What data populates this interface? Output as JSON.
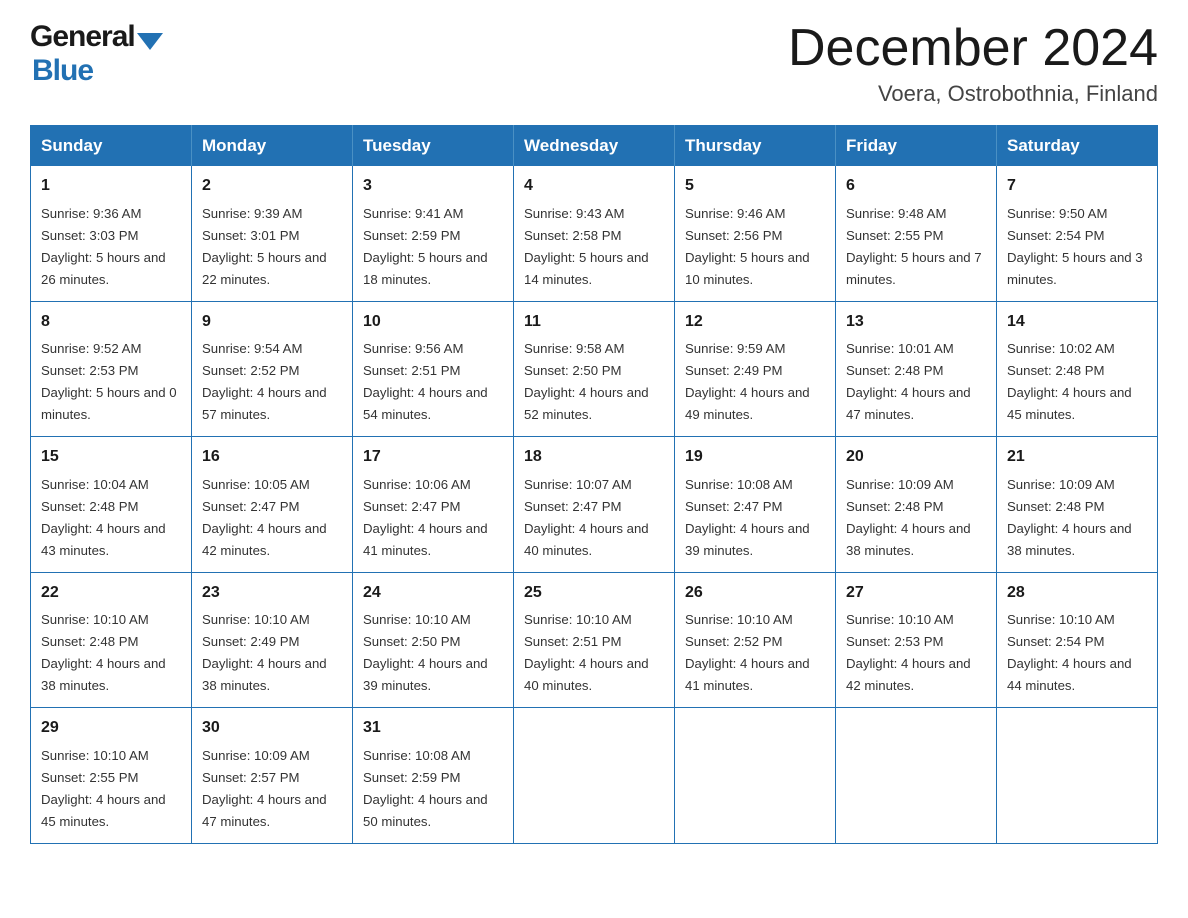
{
  "header": {
    "logo_general": "General",
    "logo_blue": "Blue",
    "month_title": "December 2024",
    "location": "Voera, Ostrobothnia, Finland"
  },
  "weekdays": [
    "Sunday",
    "Monday",
    "Tuesday",
    "Wednesday",
    "Thursday",
    "Friday",
    "Saturday"
  ],
  "weeks": [
    [
      {
        "day": "1",
        "sunrise": "Sunrise: 9:36 AM",
        "sunset": "Sunset: 3:03 PM",
        "daylight": "Daylight: 5 hours and 26 minutes."
      },
      {
        "day": "2",
        "sunrise": "Sunrise: 9:39 AM",
        "sunset": "Sunset: 3:01 PM",
        "daylight": "Daylight: 5 hours and 22 minutes."
      },
      {
        "day": "3",
        "sunrise": "Sunrise: 9:41 AM",
        "sunset": "Sunset: 2:59 PM",
        "daylight": "Daylight: 5 hours and 18 minutes."
      },
      {
        "day": "4",
        "sunrise": "Sunrise: 9:43 AM",
        "sunset": "Sunset: 2:58 PM",
        "daylight": "Daylight: 5 hours and 14 minutes."
      },
      {
        "day": "5",
        "sunrise": "Sunrise: 9:46 AM",
        "sunset": "Sunset: 2:56 PM",
        "daylight": "Daylight: 5 hours and 10 minutes."
      },
      {
        "day": "6",
        "sunrise": "Sunrise: 9:48 AM",
        "sunset": "Sunset: 2:55 PM",
        "daylight": "Daylight: 5 hours and 7 minutes."
      },
      {
        "day": "7",
        "sunrise": "Sunrise: 9:50 AM",
        "sunset": "Sunset: 2:54 PM",
        "daylight": "Daylight: 5 hours and 3 minutes."
      }
    ],
    [
      {
        "day": "8",
        "sunrise": "Sunrise: 9:52 AM",
        "sunset": "Sunset: 2:53 PM",
        "daylight": "Daylight: 5 hours and 0 minutes."
      },
      {
        "day": "9",
        "sunrise": "Sunrise: 9:54 AM",
        "sunset": "Sunset: 2:52 PM",
        "daylight": "Daylight: 4 hours and 57 minutes."
      },
      {
        "day": "10",
        "sunrise": "Sunrise: 9:56 AM",
        "sunset": "Sunset: 2:51 PM",
        "daylight": "Daylight: 4 hours and 54 minutes."
      },
      {
        "day": "11",
        "sunrise": "Sunrise: 9:58 AM",
        "sunset": "Sunset: 2:50 PM",
        "daylight": "Daylight: 4 hours and 52 minutes."
      },
      {
        "day": "12",
        "sunrise": "Sunrise: 9:59 AM",
        "sunset": "Sunset: 2:49 PM",
        "daylight": "Daylight: 4 hours and 49 minutes."
      },
      {
        "day": "13",
        "sunrise": "Sunrise: 10:01 AM",
        "sunset": "Sunset: 2:48 PM",
        "daylight": "Daylight: 4 hours and 47 minutes."
      },
      {
        "day": "14",
        "sunrise": "Sunrise: 10:02 AM",
        "sunset": "Sunset: 2:48 PM",
        "daylight": "Daylight: 4 hours and 45 minutes."
      }
    ],
    [
      {
        "day": "15",
        "sunrise": "Sunrise: 10:04 AM",
        "sunset": "Sunset: 2:48 PM",
        "daylight": "Daylight: 4 hours and 43 minutes."
      },
      {
        "day": "16",
        "sunrise": "Sunrise: 10:05 AM",
        "sunset": "Sunset: 2:47 PM",
        "daylight": "Daylight: 4 hours and 42 minutes."
      },
      {
        "day": "17",
        "sunrise": "Sunrise: 10:06 AM",
        "sunset": "Sunset: 2:47 PM",
        "daylight": "Daylight: 4 hours and 41 minutes."
      },
      {
        "day": "18",
        "sunrise": "Sunrise: 10:07 AM",
        "sunset": "Sunset: 2:47 PM",
        "daylight": "Daylight: 4 hours and 40 minutes."
      },
      {
        "day": "19",
        "sunrise": "Sunrise: 10:08 AM",
        "sunset": "Sunset: 2:47 PM",
        "daylight": "Daylight: 4 hours and 39 minutes."
      },
      {
        "day": "20",
        "sunrise": "Sunrise: 10:09 AM",
        "sunset": "Sunset: 2:48 PM",
        "daylight": "Daylight: 4 hours and 38 minutes."
      },
      {
        "day": "21",
        "sunrise": "Sunrise: 10:09 AM",
        "sunset": "Sunset: 2:48 PM",
        "daylight": "Daylight: 4 hours and 38 minutes."
      }
    ],
    [
      {
        "day": "22",
        "sunrise": "Sunrise: 10:10 AM",
        "sunset": "Sunset: 2:48 PM",
        "daylight": "Daylight: 4 hours and 38 minutes."
      },
      {
        "day": "23",
        "sunrise": "Sunrise: 10:10 AM",
        "sunset": "Sunset: 2:49 PM",
        "daylight": "Daylight: 4 hours and 38 minutes."
      },
      {
        "day": "24",
        "sunrise": "Sunrise: 10:10 AM",
        "sunset": "Sunset: 2:50 PM",
        "daylight": "Daylight: 4 hours and 39 minutes."
      },
      {
        "day": "25",
        "sunrise": "Sunrise: 10:10 AM",
        "sunset": "Sunset: 2:51 PM",
        "daylight": "Daylight: 4 hours and 40 minutes."
      },
      {
        "day": "26",
        "sunrise": "Sunrise: 10:10 AM",
        "sunset": "Sunset: 2:52 PM",
        "daylight": "Daylight: 4 hours and 41 minutes."
      },
      {
        "day": "27",
        "sunrise": "Sunrise: 10:10 AM",
        "sunset": "Sunset: 2:53 PM",
        "daylight": "Daylight: 4 hours and 42 minutes."
      },
      {
        "day": "28",
        "sunrise": "Sunrise: 10:10 AM",
        "sunset": "Sunset: 2:54 PM",
        "daylight": "Daylight: 4 hours and 44 minutes."
      }
    ],
    [
      {
        "day": "29",
        "sunrise": "Sunrise: 10:10 AM",
        "sunset": "Sunset: 2:55 PM",
        "daylight": "Daylight: 4 hours and 45 minutes."
      },
      {
        "day": "30",
        "sunrise": "Sunrise: 10:09 AM",
        "sunset": "Sunset: 2:57 PM",
        "daylight": "Daylight: 4 hours and 47 minutes."
      },
      {
        "day": "31",
        "sunrise": "Sunrise: 10:08 AM",
        "sunset": "Sunset: 2:59 PM",
        "daylight": "Daylight: 4 hours and 50 minutes."
      },
      null,
      null,
      null,
      null
    ]
  ]
}
